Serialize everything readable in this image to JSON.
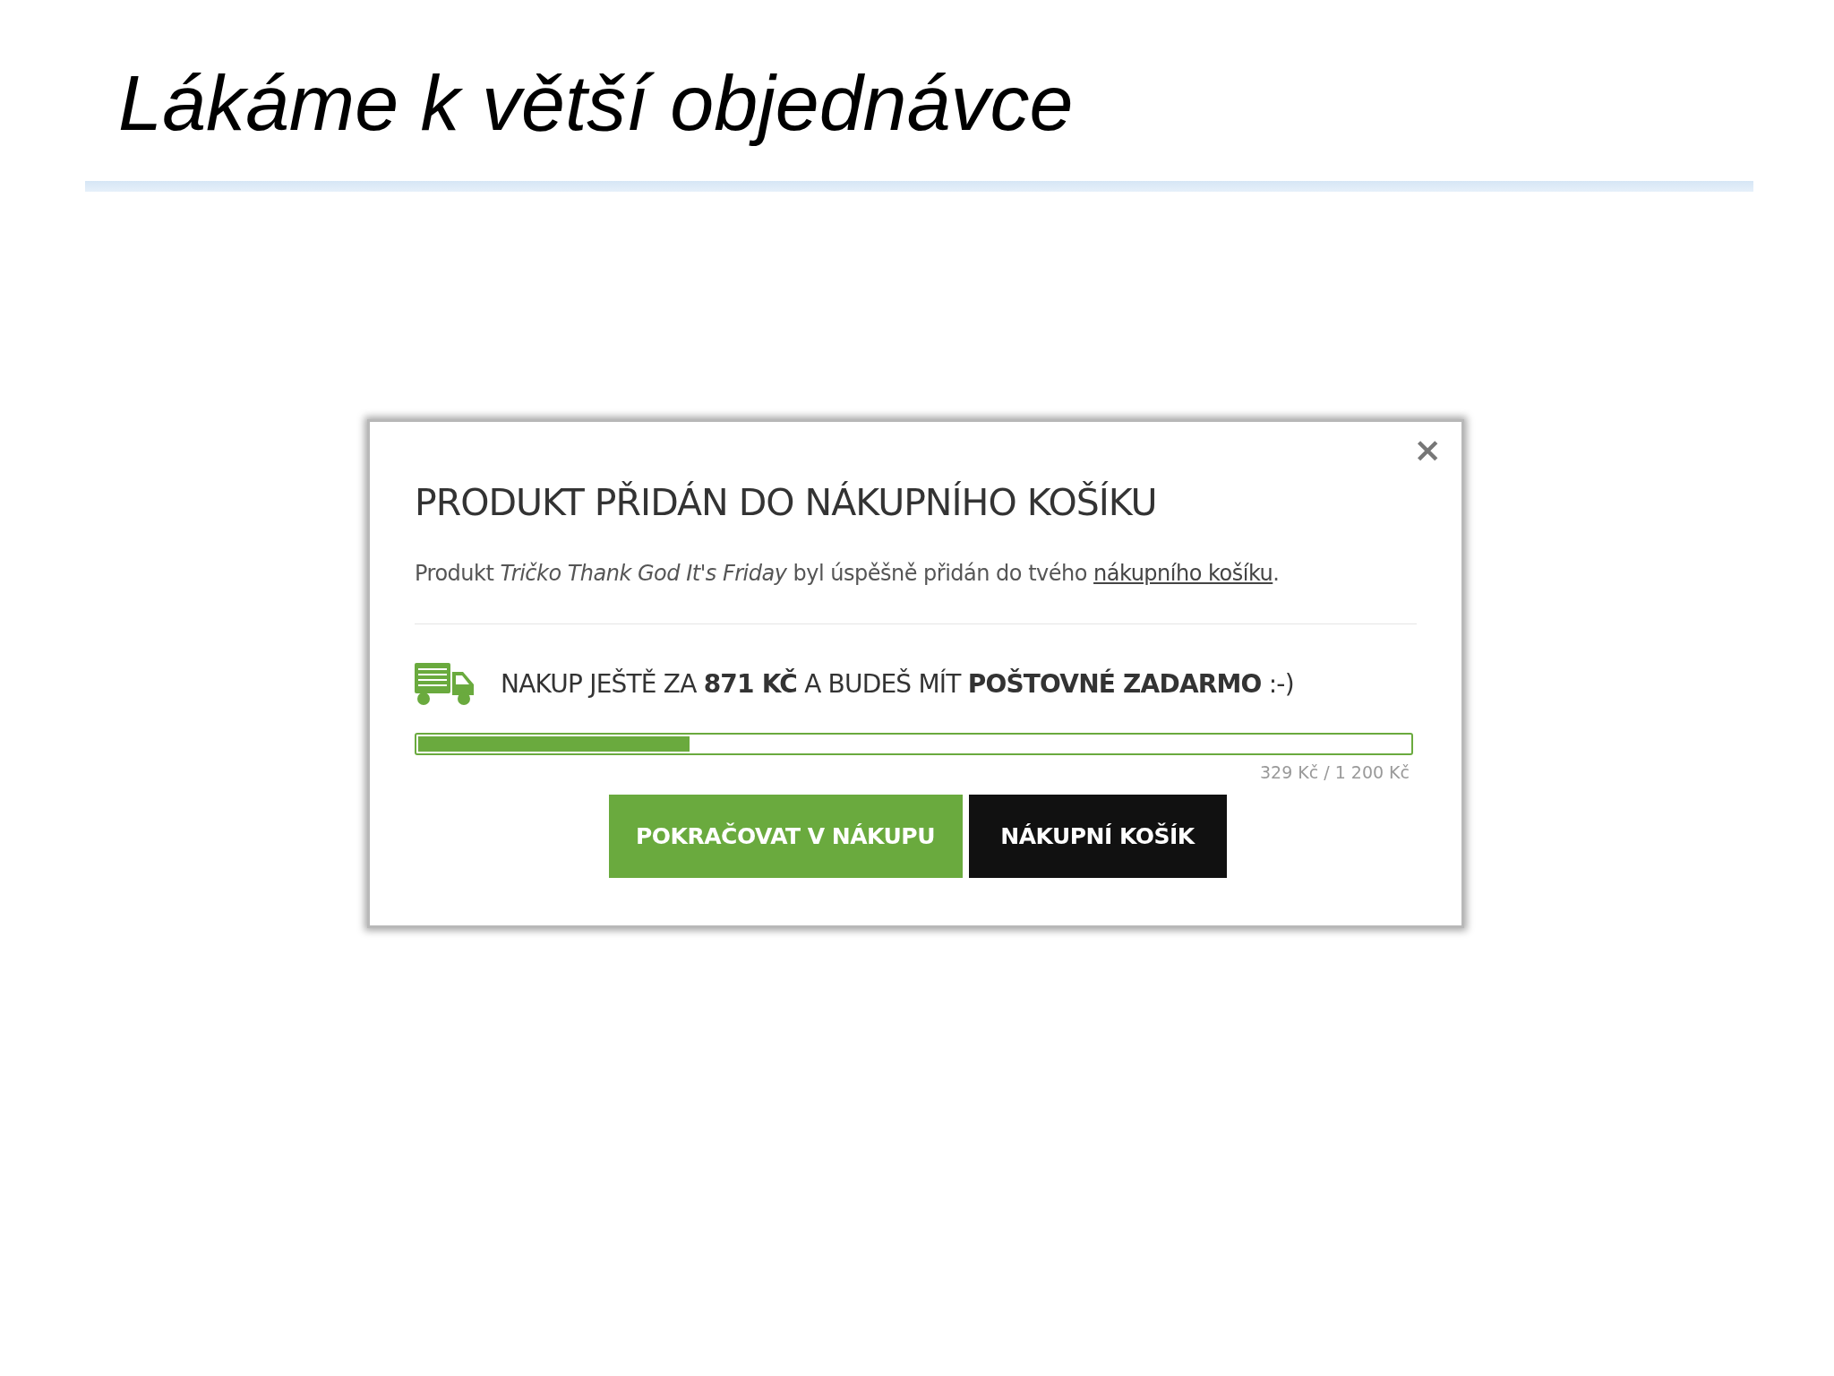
{
  "slide": {
    "title": "Lákáme k větší objednávce"
  },
  "dialog": {
    "close": "×",
    "heading": "PRODUKT PŘIDÁN DO NÁKUPNÍHO KOŠÍKU",
    "message": {
      "before": "Produkt *Tričko Thank God It's Friday* byl úspěšně přidán do tvého ",
      "link": "nákupního košíku",
      "after": "."
    },
    "shipping": {
      "text": "NAKUP JEŠTĚ ZA **871 KČ** A BUDEŠ MÍT **POŠTOVNÉ ZADARMO** :-)",
      "level": 0.274,
      "reading": "329 Kč / 1 200 Kč"
    },
    "buttons": [
      {
        "label": "POKRAČOVAT V NÁKUPU",
        "kind": "primary"
      },
      {
        "label": "NÁKUPNÍ KOŠÍK",
        "kind": "dark"
      }
    ]
  }
}
